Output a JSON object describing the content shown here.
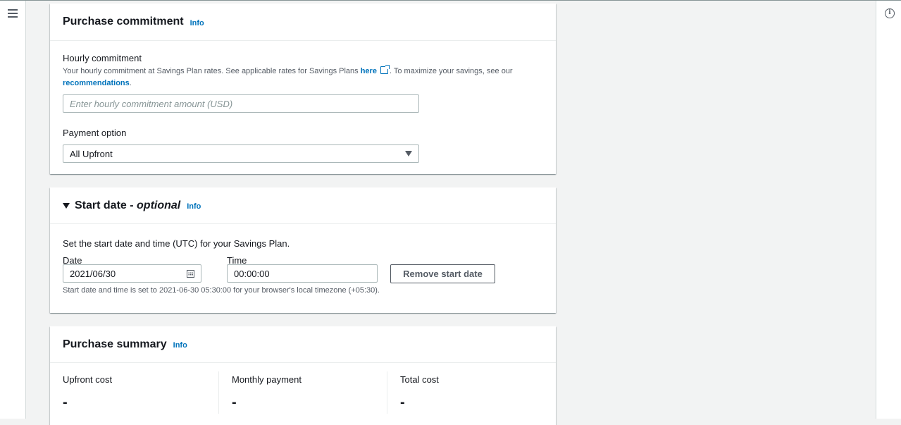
{
  "purchase_commitment": {
    "title": "Purchase commitment",
    "info": "Info",
    "hourly_label": "Hourly commitment",
    "hourly_desc_part1": "Your hourly commitment at Savings Plan rates. See applicable rates for Savings Plans ",
    "hourly_desc_link_here": "here",
    "hourly_desc_part2": ". To maximize your savings, see our",
    "hourly_desc_link_recommendations": "recommendations",
    "hourly_desc_part3": ".",
    "hourly_placeholder": "Enter hourly commitment amount (USD)",
    "payment_label": "Payment option",
    "payment_value": "All Upfront"
  },
  "start_date": {
    "title": "Start date - ",
    "title_optional": "optional",
    "info": "Info",
    "desc": "Set the start date and time (UTC) for your Savings Plan.",
    "date_label": "Date",
    "date_value": "2021/06/30",
    "time_label": "Time",
    "time_value": "00:00:00",
    "remove_button": "Remove start date",
    "note": "Start date and time is set to 2021-06-30 05:30:00 for your browser's local timezone (+05:30)."
  },
  "purchase_summary": {
    "title": "Purchase summary",
    "info": "Info",
    "columns": [
      {
        "label": "Upfront cost",
        "value": "-"
      },
      {
        "label": "Monthly payment",
        "value": "-"
      },
      {
        "label": "Total cost",
        "value": "-"
      }
    ]
  },
  "icons": {
    "menu": "hamburger-icon",
    "help": "info-circle-icon",
    "external": "external-link-icon",
    "calendar": "calendar-icon",
    "dropdown": "caret-down-icon"
  },
  "colors": {
    "link": "#0073bb",
    "text": "#16191f",
    "muted": "#545b64",
    "border": "#aab7b8"
  }
}
